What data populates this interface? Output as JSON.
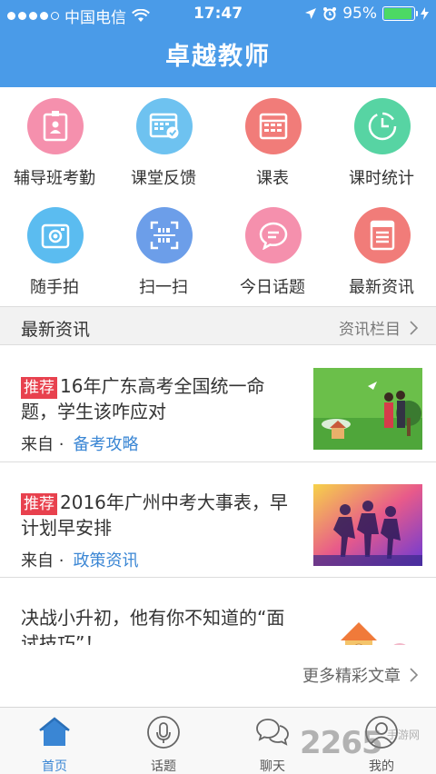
{
  "status_bar": {
    "carrier": "中国电信",
    "time": "17:47",
    "battery": "95%",
    "battery_level": 0.95
  },
  "header": {
    "title": "卓越教师"
  },
  "grid": [
    {
      "label": "辅导班考勤",
      "icon": "badge-icon",
      "color": "#f590ad"
    },
    {
      "label": "课堂反馈",
      "icon": "calendar-check-icon",
      "color": "#6ec2f0"
    },
    {
      "label": "课表",
      "icon": "schedule-icon",
      "color": "#f17c79"
    },
    {
      "label": "课时统计",
      "icon": "clock-icon",
      "color": "#57d4a3"
    },
    {
      "label": "随手拍",
      "icon": "camera-icon",
      "color": "#5bbcf0"
    },
    {
      "label": "扫一扫",
      "icon": "scan-icon",
      "color": "#6c9ee9"
    },
    {
      "label": "今日话题",
      "icon": "chat-bubble-icon",
      "color": "#f590ad"
    },
    {
      "label": "最新资讯",
      "icon": "news-icon",
      "color": "#f17c79"
    }
  ],
  "section": {
    "title": "最新资讯",
    "more": "资讯栏目"
  },
  "news": [
    {
      "tag": "推荐",
      "title": "16年广东高考全国统一命题，学生该咋应对",
      "from": "来自",
      "dot": "·",
      "source": "备考攻略"
    },
    {
      "tag": "推荐",
      "title": "2016年广州中考大事表，早计划早安排",
      "from": "来自",
      "dot": "·",
      "source": "政策资讯"
    },
    {
      "tag": "",
      "title": "决战小升初，他有你不知道的“面试技巧”！",
      "from": "",
      "dot": "",
      "source": ""
    }
  ],
  "more_articles": "更多精彩文章",
  "tabbar": [
    {
      "label": "首页",
      "icon": "home-icon",
      "active": true
    },
    {
      "label": "话题",
      "icon": "microphone-icon",
      "active": false
    },
    {
      "label": "聊天",
      "icon": "chat-icon",
      "active": false
    },
    {
      "label": "我的",
      "icon": "user-icon",
      "active": false
    }
  ],
  "watermark": {
    "main": "2265",
    "sub": "手游网"
  },
  "colors": {
    "primary": "#4a9be8",
    "tag": "#e8414e",
    "link": "#3a86d4"
  }
}
